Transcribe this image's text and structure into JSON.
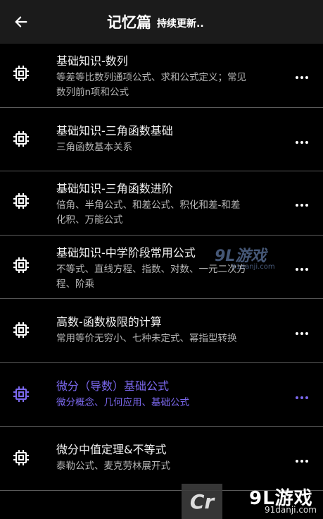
{
  "header": {
    "title": "记忆篇",
    "subtitle": "持续更新.."
  },
  "items": [
    {
      "title": "基础知识-数列",
      "desc_line1": "等差等比数列通项公式、求和公式定义；常见",
      "desc_line2": "数列前n项和公式"
    },
    {
      "title": "基础知识-三角函数基础",
      "desc_line1": "三角函数基本关系",
      "desc_line2": ""
    },
    {
      "title": "基础知识-三角函数进阶",
      "desc_line1": "倍角、半角公式、和差公式、积化和差-和差",
      "desc_line2": "化积、万能公式"
    },
    {
      "title": "基础知识-中学阶段常用公式",
      "desc_line1": "不等式、直线方程、指数、对数、一元二次方",
      "desc_line2": "程、阶乘"
    },
    {
      "title": "高数-函数极限的计算",
      "desc_line1": "常用等价无穷小、七种未定式、幂指型转换",
      "desc_line2": ""
    },
    {
      "title": "微分（导数）基础公式",
      "desc_line1": "微分概念、几何应用、基础公式",
      "desc_line2": ""
    },
    {
      "title": "微分中值定理&不等式",
      "desc_line1": "泰勒公式、麦克劳林展开式",
      "desc_line2": ""
    }
  ],
  "icons": {
    "back": "arrow-left-icon",
    "item": "chip-icon",
    "more": "more-horizontal-icon"
  },
  "colors": {
    "background": "#000000",
    "header": "#1b1b1b",
    "accent": "#7b68ee",
    "divider": "#5a5a5a",
    "text_secondary": "#b5b5b5"
  },
  "watermark": {
    "center_brand": "9L游戏",
    "center_url": "91danji.com",
    "bottom_brand": "9L游戏",
    "bottom_url": "91danji.com",
    "logo_text": "Cr"
  }
}
